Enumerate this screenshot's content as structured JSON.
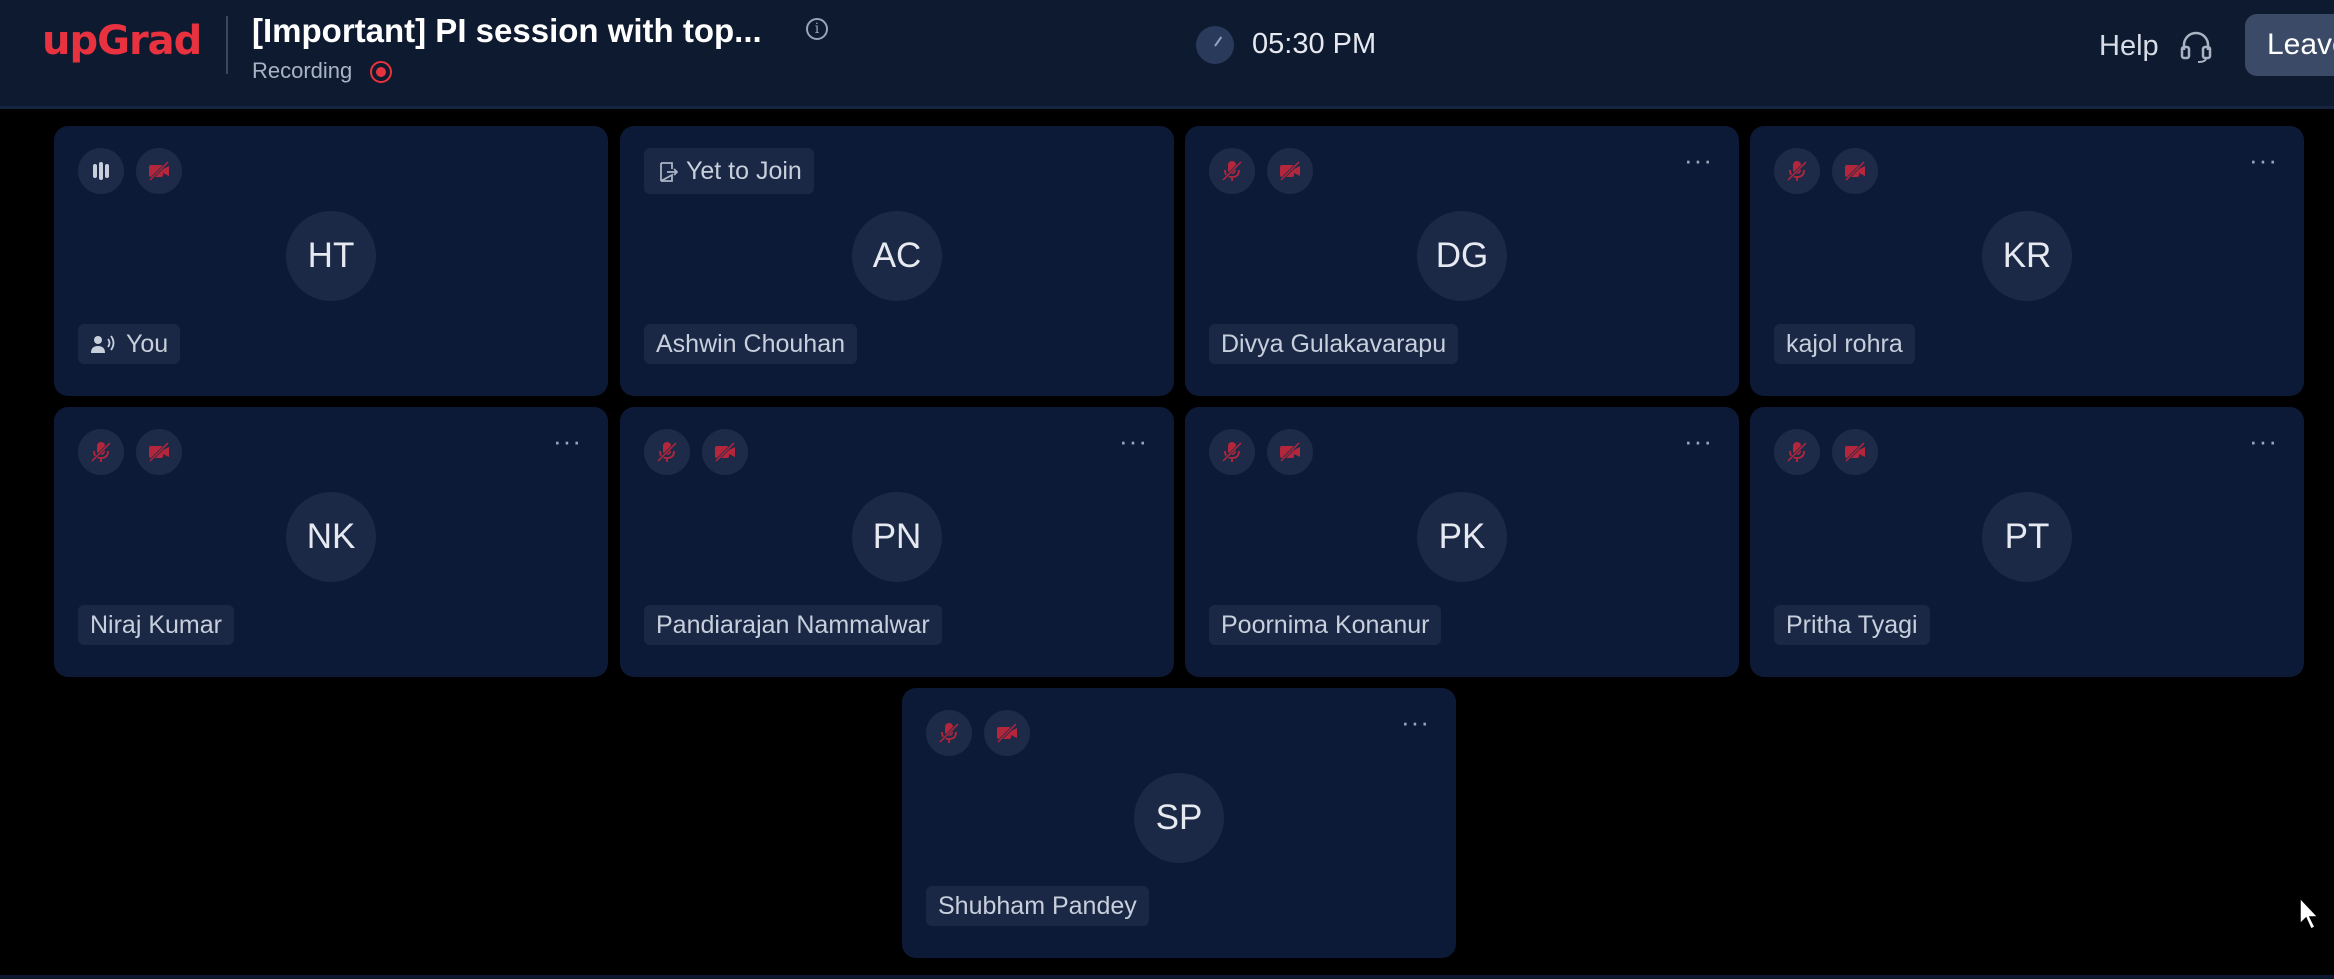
{
  "header": {
    "logo": "upGrad",
    "title": "[Important] PI session with top...",
    "recording_label": "Recording",
    "time": "05:30 PM",
    "help_label": "Help",
    "leave_label": "Leave"
  },
  "colors": {
    "brand": "#e8323f",
    "tile_bg": "#0c1a37",
    "muted_icon": "#b3263c"
  },
  "tiles": [
    {
      "initials": "HT",
      "name": "You",
      "mic": "audio-level-icon",
      "cam": "camera-off-icon"
    },
    {
      "initials": "AC",
      "name": "Ashwin Chouhan",
      "status": "Yet to Join"
    },
    {
      "initials": "DG",
      "name": "Divya Gulakavarapu",
      "mic": "mic-off-icon",
      "cam": "camera-off-icon"
    },
    {
      "initials": "KR",
      "name": "kajol rohra",
      "mic": "mic-off-icon",
      "cam": "camera-off-icon"
    },
    {
      "initials": "NK",
      "name": "Niraj Kumar",
      "mic": "mic-off-icon",
      "cam": "camera-off-icon"
    },
    {
      "initials": "PN",
      "name": "Pandiarajan Nammalwar",
      "mic": "mic-off-icon",
      "cam": "camera-off-icon"
    },
    {
      "initials": "PK",
      "name": "Poornima Konanur",
      "mic": "mic-off-icon",
      "cam": "camera-off-icon"
    },
    {
      "initials": "PT",
      "name": "Pritha Tyagi",
      "mic": "mic-off-icon",
      "cam": "camera-off-icon"
    },
    {
      "initials": "SP",
      "name": "Shubham Pandey",
      "mic": "mic-off-icon",
      "cam": "camera-off-icon"
    }
  ],
  "more_label": "···"
}
